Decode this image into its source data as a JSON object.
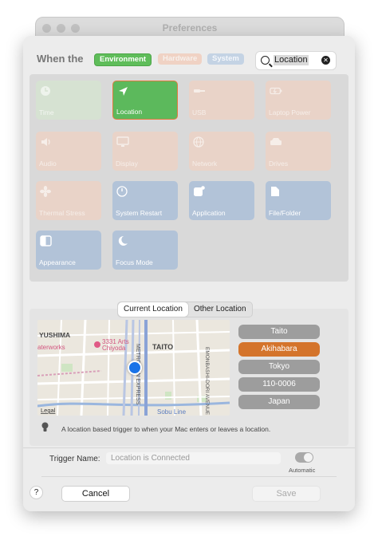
{
  "window": {
    "title": "Preferences"
  },
  "header": {
    "label": "When the"
  },
  "categories": [
    {
      "label": "Environment",
      "state": "active"
    },
    {
      "label": "Hardware",
      "state": "inactive"
    },
    {
      "label": "System",
      "state": "inactive"
    }
  ],
  "search": {
    "value": "Location"
  },
  "triggers": [
    {
      "label": "Time",
      "group": "environment",
      "icon": "clock-icon"
    },
    {
      "label": "Location",
      "group": "environment",
      "icon": "location-arrow-icon",
      "selected": true
    },
    {
      "label": "USB",
      "group": "hardware",
      "icon": "usb-icon"
    },
    {
      "label": "Laptop Power",
      "group": "hardware",
      "icon": "battery-icon"
    },
    {
      "label": "Audio",
      "group": "hardware",
      "icon": "speaker-icon"
    },
    {
      "label": "Display",
      "group": "hardware",
      "icon": "display-icon"
    },
    {
      "label": "Network",
      "group": "hardware",
      "icon": "globe-icon"
    },
    {
      "label": "Drives",
      "group": "hardware",
      "icon": "drive-icon"
    },
    {
      "label": "Thermal Stress",
      "group": "hardware",
      "icon": "fan-icon"
    },
    {
      "label": "System Restart",
      "group": "system",
      "icon": "power-icon"
    },
    {
      "label": "Application",
      "group": "system",
      "icon": "application-icon"
    },
    {
      "label": "File/Folder",
      "group": "system",
      "icon": "document-icon"
    },
    {
      "label": "Appearance",
      "group": "system",
      "icon": "appearance-icon"
    },
    {
      "label": "Focus Mode",
      "group": "system",
      "icon": "moon-icon"
    }
  ],
  "location_tabs": [
    {
      "label": "Current Location",
      "active": true
    },
    {
      "label": "Other Location",
      "active": false
    }
  ],
  "map": {
    "labels": {
      "yushima": "YUSHIMA",
      "taito": "TAITO",
      "waterworks": "aterworks",
      "arts_line1": "3331 Arts",
      "arts_line2": "Chiyoda",
      "avenue1": "METRO",
      "avenue2": "ITAN EXPRESS",
      "avenue3": "EMONBASHI-DORI AVENUE",
      "sobu": "Sobu Line",
      "legal": "Legal"
    }
  },
  "location_chips": [
    {
      "label": "Taito",
      "active": false
    },
    {
      "label": "Akihabara",
      "active": true
    },
    {
      "label": "Tokyo",
      "active": false
    },
    {
      "label": "110-0006",
      "active": false
    },
    {
      "label": "Japan",
      "active": false
    }
  ],
  "description": "A location based trigger to when your Mac enters or leaves a location.",
  "trigger_name": {
    "label": "Trigger Name:",
    "placeholder": "Location is Connected"
  },
  "automatic": {
    "label": "Automatic"
  },
  "footer": {
    "help": "?",
    "cancel": "Cancel",
    "save": "Save"
  },
  "colors": {
    "accent_green": "#5cb95c",
    "selection_orange": "#d4742b",
    "system_blue": "#b2c3d8"
  }
}
